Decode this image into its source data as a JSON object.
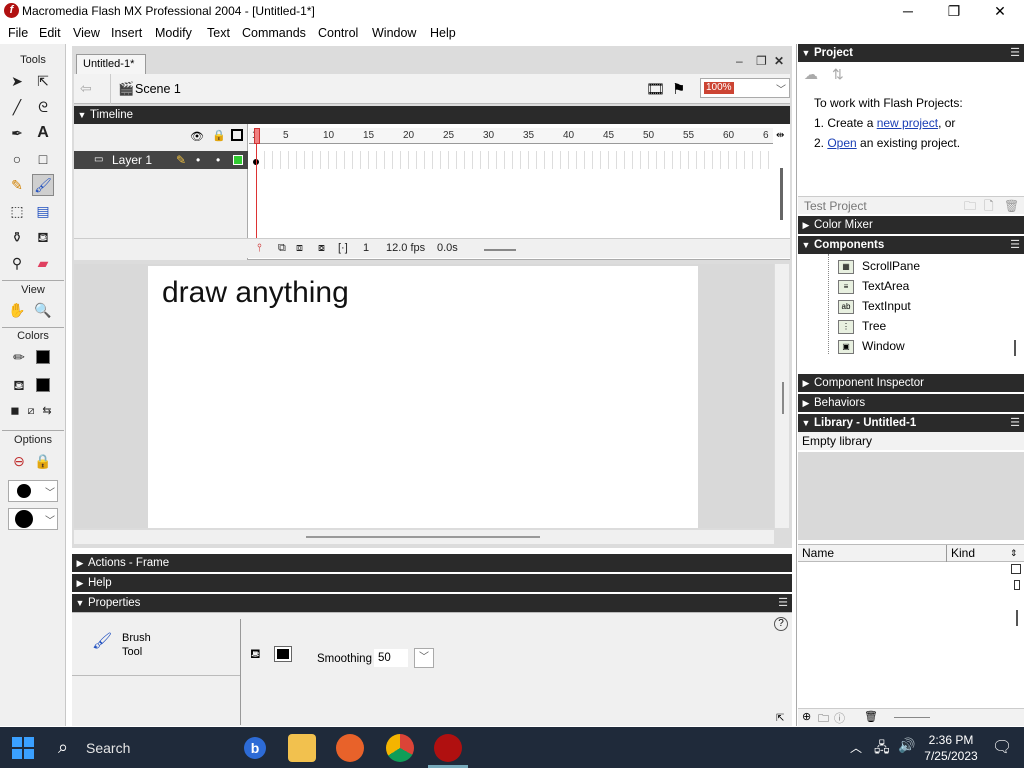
{
  "window": {
    "title": "Macromedia Flash MX Professional 2004 - [Untitled-1*]",
    "minimize": "─",
    "maximize": "❐",
    "close": "✕"
  },
  "menu": [
    "File",
    "Edit",
    "View",
    "Insert",
    "Modify",
    "Text",
    "Commands",
    "Control",
    "Window",
    "Help"
  ],
  "tools": {
    "label": "Tools",
    "view_label": "View",
    "colors_label": "Colors",
    "options_label": "Options"
  },
  "document": {
    "tab": "Untitled-1*",
    "scene": "Scene 1",
    "zoom": "100%"
  },
  "timeline": {
    "title": "Timeline",
    "layer_name": "Layer 1",
    "ruler_ticks": [
      "1",
      "5",
      "10",
      "15",
      "20",
      "25",
      "30",
      "35",
      "40",
      "45",
      "50",
      "55",
      "60",
      "6"
    ],
    "current_frame": "1",
    "fps": "12.0 fps",
    "elapsed": "0.0s"
  },
  "stage": {
    "text": "draw anything"
  },
  "panels": {
    "actions": "Actions - Frame",
    "help": "Help",
    "properties": "Properties"
  },
  "properties": {
    "tool_line1": "Brush",
    "tool_line2": "Tool",
    "smoothing_label": "Smoothing",
    "smoothing_value": "50",
    "help_icon": "?"
  },
  "project": {
    "title": "Project",
    "intro": "To work with Flash Projects:",
    "step1_prefix": "1. Create a ",
    "step1_link": "new project",
    "step1_suffix": ", or",
    "step2_prefix": "2. ",
    "step2_link": "Open",
    "step2_suffix": " an existing project.",
    "footer": "Test Project"
  },
  "right_panels": {
    "color_mixer": "Color Mixer",
    "components": "Components",
    "component_inspector": "Component Inspector",
    "behaviors": "Behaviors",
    "library": "Library - Untitled-1"
  },
  "components": [
    "ScrollPane",
    "TextArea",
    "TextInput",
    "Tree",
    "Window"
  ],
  "library": {
    "status": "Empty library",
    "col_name": "Name",
    "col_kind": "Kind"
  },
  "taskbar": {
    "search": "Search",
    "time": "2:36 PM",
    "date": "7/25/2023"
  },
  "colors": {
    "titlebar": "#ffffff",
    "panel_header": "#2a2a2a",
    "selected_layer": "#444444",
    "playhead": "#dd3333",
    "taskbar": "#1f2a3a",
    "link": "#1a3fb5"
  }
}
